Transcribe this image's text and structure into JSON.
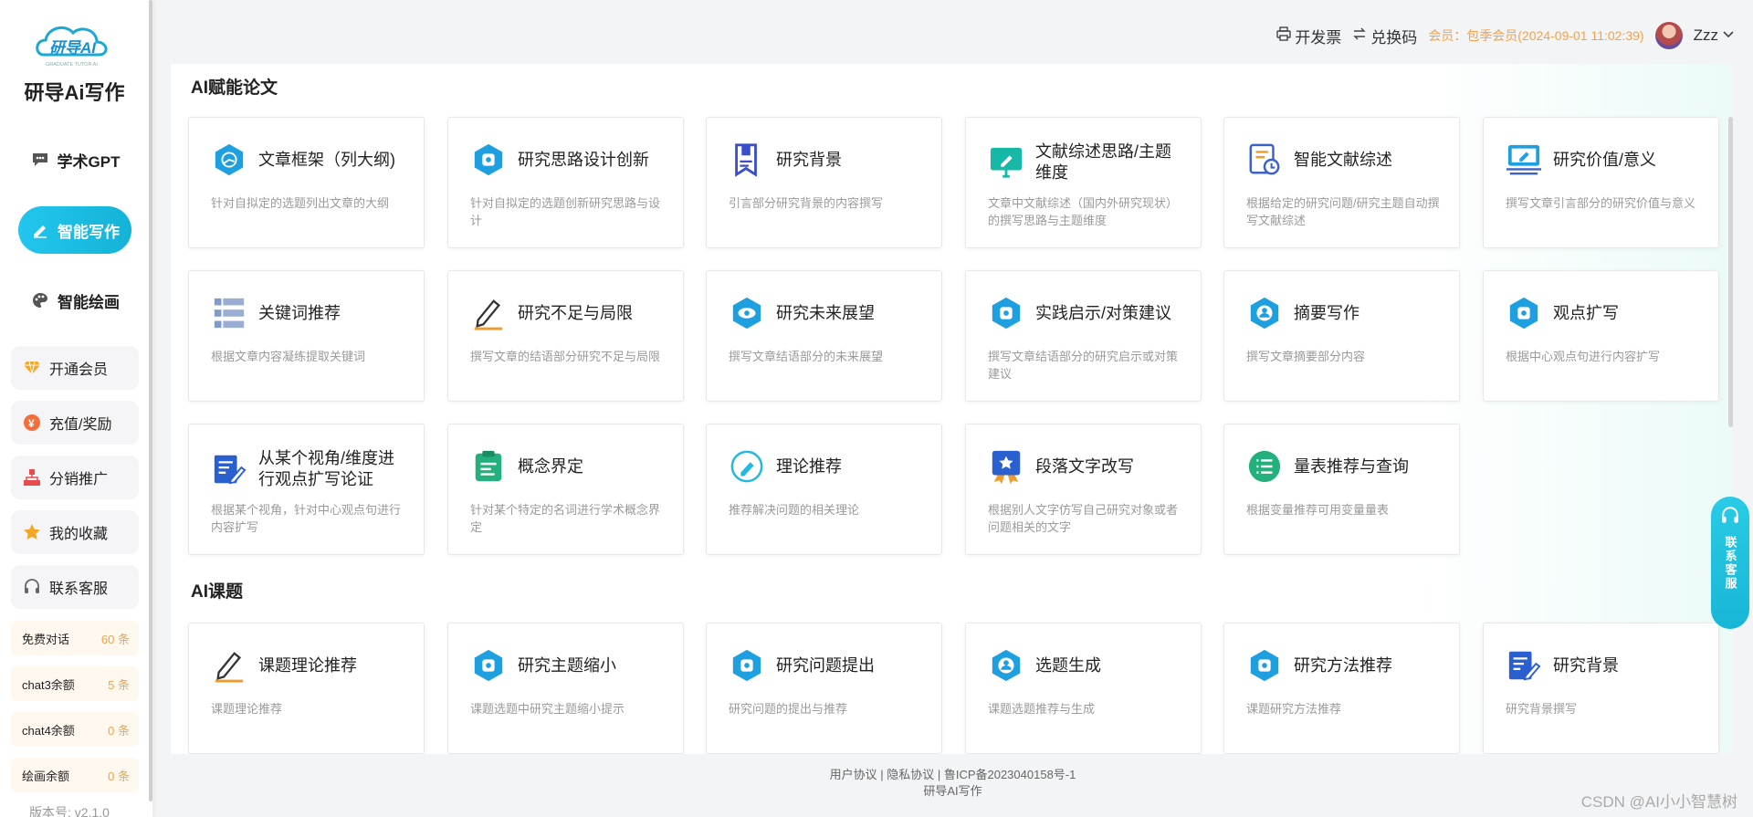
{
  "sidebar": {
    "logo_text": "研导AI",
    "logo_sub": "GRADUATE TUTOR AI",
    "brand": "研导Ai写作",
    "nav": [
      {
        "label": "学术GPT",
        "icon": "chat-bubble-icon"
      },
      {
        "label": "智能写作",
        "icon": "pencil-icon"
      },
      {
        "label": "智能绘画",
        "icon": "palette-icon"
      }
    ],
    "menu": [
      {
        "label": "开通会员",
        "icon": "diamond-icon"
      },
      {
        "label": "充值/奖励",
        "icon": "coin-icon"
      },
      {
        "label": "分销推广",
        "icon": "org-chart-icon"
      },
      {
        "label": "我的收藏",
        "icon": "star-icon"
      },
      {
        "label": "联系客服",
        "icon": "headset-icon"
      }
    ],
    "quotas": [
      {
        "label": "免费对话",
        "value": "60 条"
      },
      {
        "label": "chat3余额",
        "value": "5 条"
      },
      {
        "label": "chat4余额",
        "value": "0 条"
      },
      {
        "label": "绘画余额",
        "value": "0 条"
      }
    ],
    "version": "版本号: v2.1.0"
  },
  "header": {
    "invoice": "开发票",
    "redeem": "兑换码",
    "member": "会员：包季会员(2024-09-01 11:02:39)",
    "username": "Zzz"
  },
  "sections": {
    "ai_paper": "AI赋能论文",
    "ai_topic": "AI课题"
  },
  "cards_paper": [
    {
      "title": "文章框架（列大纲)",
      "desc": "针对自拟定的选题列出文章的大纲",
      "icon": "framework-icon"
    },
    {
      "title": "研究思路设计创新",
      "desc": "针对自拟定的选题创新研究思路与设计",
      "icon": "hexagon-icon"
    },
    {
      "title": "研究背景",
      "desc": "引言部分研究背景的内容撰写",
      "icon": "bookmark-icon"
    },
    {
      "title": "文献综述思路/主题维度",
      "desc": "文章中文献综述（国内外研究现状）的撰写思路与主题维度",
      "icon": "board-icon"
    },
    {
      "title": "智能文献综述",
      "desc": "根据给定的研究问题/研究主题自动撰写文献综述",
      "icon": "document-clock-icon"
    },
    {
      "title": "研究价值/意义",
      "desc": "撰写文章引言部分的研究价值与意义",
      "icon": "laptop-icon"
    },
    {
      "title": "关键词推荐",
      "desc": "根据文章内容凝练提取关键词",
      "icon": "list-icon"
    },
    {
      "title": "研究不足与局限",
      "desc": "撰写文章的结语部分研究不足与局限",
      "icon": "pen-icon"
    },
    {
      "title": "研究未来展望",
      "desc": "撰写文章结语部分的未来展望",
      "icon": "eye-icon"
    },
    {
      "title": "实践启示/对策建议",
      "desc": "撰写文章结语部分的研究启示或对策建议",
      "icon": "hexagon-icon"
    },
    {
      "title": "摘要写作",
      "desc": "撰写文章摘要部分内容",
      "icon": "user-hexagon-icon"
    },
    {
      "title": "观点扩写",
      "desc": "根据中心观点句进行内容扩写",
      "icon": "hexagon-icon"
    },
    {
      "title": "从某个视角/维度进行观点扩写论证",
      "desc": "根据某个视角，针对中心观点句进行内容扩写",
      "icon": "document-pen-icon"
    },
    {
      "title": "概念界定",
      "desc": "针对某个特定的名词进行学术概念界定",
      "icon": "clipboard-icon"
    },
    {
      "title": "理论推荐",
      "desc": "推荐解决问题的相关理论",
      "icon": "edit-circle-icon"
    },
    {
      "title": "段落文字改写",
      "desc": "根据别人文字仿写自己研究对象或者问题相关的文字",
      "icon": "badge-icon"
    },
    {
      "title": "量表推荐与查询",
      "desc": "根据变量推荐可用变量量表",
      "icon": "list-circle-icon"
    }
  ],
  "cards_topic": [
    {
      "title": "课题理论推荐",
      "desc": "课题理论推荐",
      "icon": "pen-icon"
    },
    {
      "title": "研究主题缩小",
      "desc": "课题选题中研究主题缩小提示",
      "icon": "hexagon-icon"
    },
    {
      "title": "研究问题提出",
      "desc": "研究问题的提出与推荐",
      "icon": "hexagon-icon"
    },
    {
      "title": "选题生成",
      "desc": "课题选题推荐与生成",
      "icon": "user-hexagon-icon"
    },
    {
      "title": "研究方法推荐",
      "desc": "课题研究方法推荐",
      "icon": "hexagon-icon"
    },
    {
      "title": "研究背景",
      "desc": "研究背景撰写",
      "icon": "document-pen-icon"
    }
  ],
  "footer": {
    "links": "用户协议 | 隐私协议 | 鲁ICP备2023040158号-1",
    "name": "研导AI写作"
  },
  "float_cs": "联系客服",
  "watermark": "CSDN @AI小小智慧树",
  "colors": {
    "accent": "#1bbcde",
    "member": "#f2a24a"
  }
}
